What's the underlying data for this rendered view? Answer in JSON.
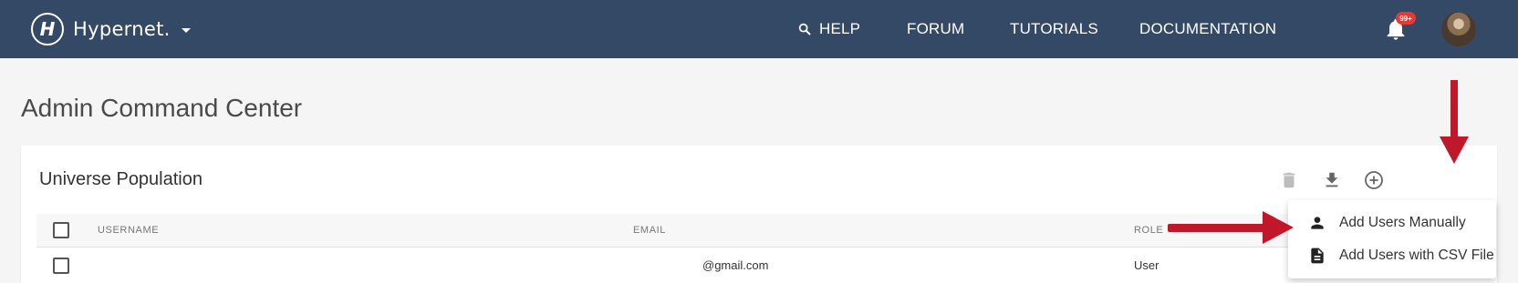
{
  "navbar": {
    "brand_glyph": "H",
    "brand_name": "Hypernet.",
    "links": [
      {
        "label": "HELP",
        "icon": "search-icon"
      },
      {
        "label": "FORUM"
      },
      {
        "label": "TUTORIALS"
      },
      {
        "label": "DOCUMENTATION"
      }
    ],
    "notifications_badge": "99+",
    "background_color": "#344966"
  },
  "page": {
    "title": "Admin Command Center"
  },
  "card": {
    "title": "Universe Population",
    "actions": [
      "delete-icon",
      "download-icon",
      "add-circle-icon"
    ]
  },
  "table": {
    "columns": [
      "USERNAME",
      "EMAIL",
      "ROLE"
    ],
    "rows": [
      {
        "username": "",
        "email": "@gmail.com",
        "role": "User"
      }
    ]
  },
  "menu": {
    "items": [
      {
        "label": "Add Users Manually",
        "icon": "person-icon"
      },
      {
        "label": "Add Users with CSV File",
        "icon": "file-icon"
      }
    ]
  },
  "annotation_color": "#c0182a"
}
